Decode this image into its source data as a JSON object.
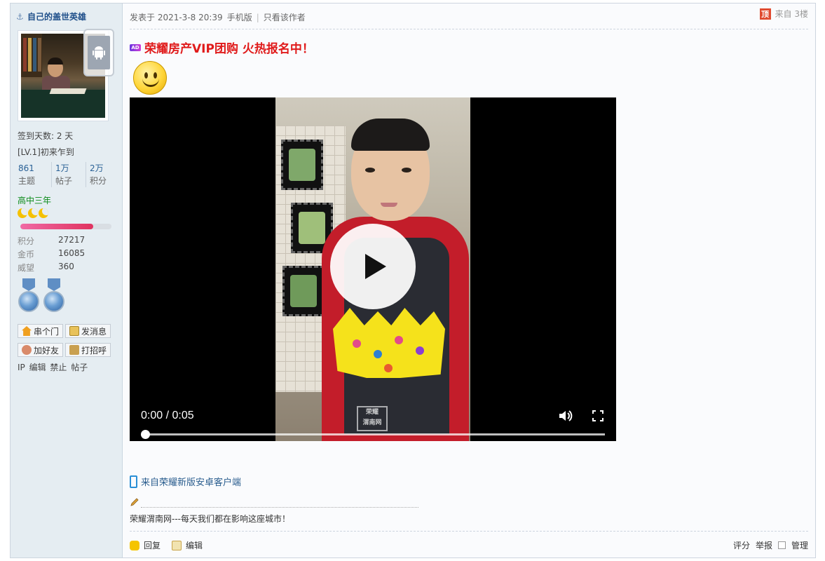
{
  "user": {
    "name": "自己的盖世英雄",
    "sign_days": "签到天数: 2 天",
    "level": "[LV.1]初来乍到",
    "stats": [
      {
        "num": "861",
        "label": "主题"
      },
      {
        "num": "1万",
        "label": "帖子"
      },
      {
        "num": "2万",
        "label": "积分"
      }
    ],
    "grade": "高中三年",
    "level_progress": 0.8,
    "kv": [
      {
        "k": "积分",
        "v": "27217"
      },
      {
        "k": "金币",
        "v": "16085"
      },
      {
        "k": "威望",
        "v": "360"
      }
    ],
    "buttons": {
      "visit": "串个门",
      "message": "发消息",
      "add_friend": "加好友",
      "greet": "打招呼"
    },
    "admin_line": "IP 编辑 禁止 帖子"
  },
  "post": {
    "meta_prefix": "发表于 2021-3-8 20:39",
    "meta_platform": "手机版",
    "meta_sep": "|",
    "author_only": "只看该作者",
    "top_icon": "顶",
    "floor": "来自 3楼",
    "ad_tag": "AD",
    "ad_text": "荣耀房产VIP团购 火热报名中！",
    "video": {
      "time": "0:00 / 0:05",
      "progress": 0,
      "watermark_line1": "荣耀",
      "watermark_line2": "渭南网"
    },
    "client_text": "来自荣耀新版安卓客户端",
    "signature": "荣耀渭南网---每天我们都在影响这座城市！"
  },
  "actions": {
    "reply": "回复",
    "edit": "编辑",
    "rate": "评分",
    "report": "举报",
    "manage": "管理"
  },
  "colors": {
    "accent_link": "#2a6196",
    "ad_red": "#e01b1b",
    "grade_green": "#0a8a18",
    "sidebar_bg": "#e5edf2"
  }
}
